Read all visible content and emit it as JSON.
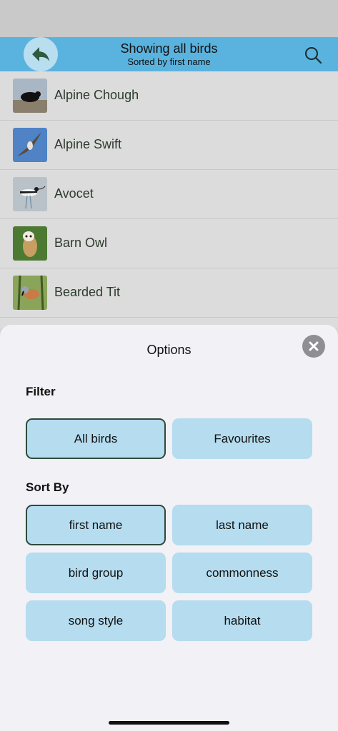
{
  "nav": {
    "title": "Showing all birds",
    "subtitle": "Sorted by first name"
  },
  "birds": [
    {
      "name": "Alpine Chough"
    },
    {
      "name": "Alpine Swift"
    },
    {
      "name": "Avocet"
    },
    {
      "name": "Barn Owl"
    },
    {
      "name": "Bearded Tit"
    }
  ],
  "options": {
    "title": "Options",
    "filter": {
      "heading": "Filter",
      "choices": [
        "All birds",
        "Favourites"
      ],
      "selected": "All birds"
    },
    "sort": {
      "heading": "Sort By",
      "choices": [
        "first name",
        "last name",
        "bird group",
        "commonness",
        "song style",
        "habitat"
      ],
      "selected": "first name"
    }
  },
  "colors": {
    "nav_bar": "#5ab3de",
    "option_button": "#b5dcef",
    "selected_border": "#2f4a3c",
    "back_arrow": "#2e5a3e"
  },
  "icons": {
    "back": "back-arrow-icon",
    "search": "search-icon",
    "close": "close-icon"
  }
}
